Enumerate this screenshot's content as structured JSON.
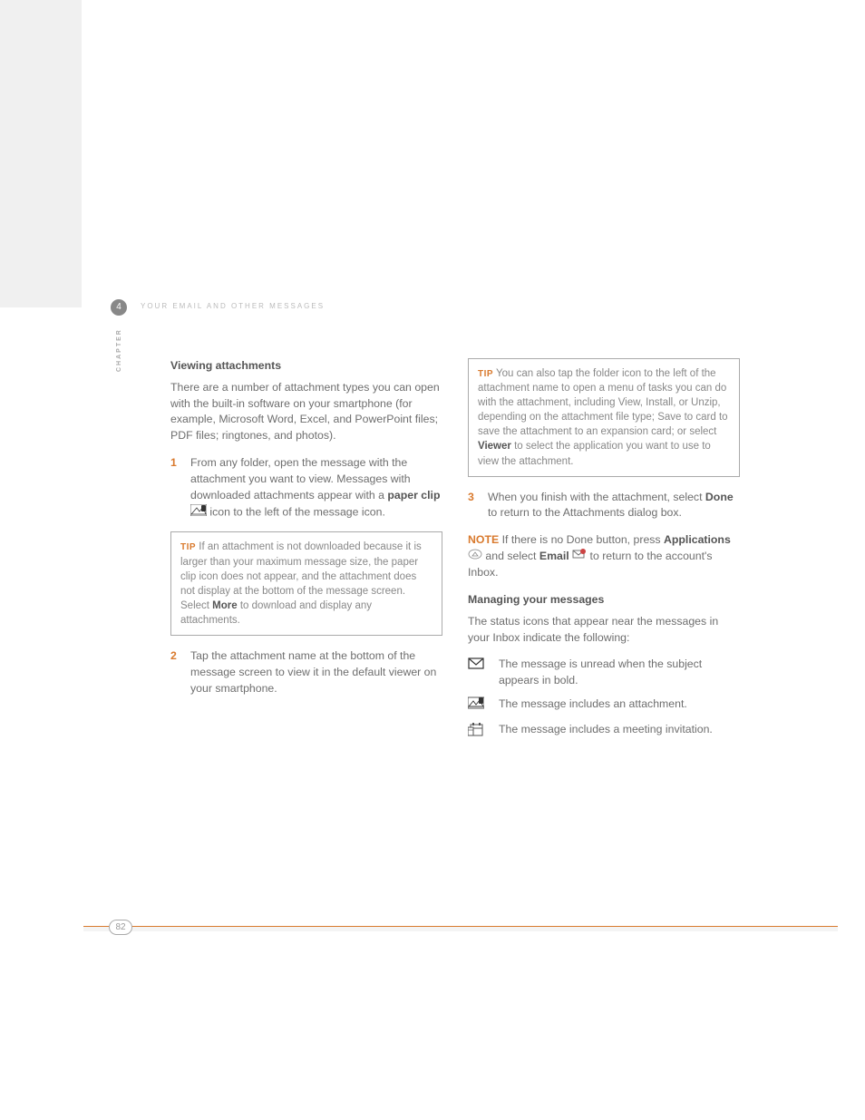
{
  "header": {
    "chapter_num": "4",
    "running_head": "YOUR EMAIL AND OTHER MESSAGES",
    "chapter_label": "CHAPTER"
  },
  "col1": {
    "heading": "Viewing attachments",
    "intro": "There are a number of attachment types you can open with the built-in software on your smartphone (for example, Microsoft Word, Excel, and PowerPoint files; PDF files; ringtones, and photos).",
    "step1_num": "1",
    "step1a": "From any folder, open the message with the attachment you want to view. Messages with downloaded attachments appear with a ",
    "step1_bold": "paper clip",
    "step1b": " icon to the left of the message icon.",
    "tip_label": "TIP",
    "tip_a": " If an attachment is not downloaded because it is larger than your maximum message size, the paper clip icon does not appear, and the attachment does not display at the bottom of the message screen. Select ",
    "tip_bold": "More",
    "tip_b": " to download and display any attachments.",
    "step2_num": "2",
    "step2": "Tap the attachment name at the bottom of the message screen to view it in the default viewer on your smartphone."
  },
  "col2": {
    "tip2_label": "TIP",
    "tip2a": " You can also tap the folder icon to the left of the attachment name to open a menu of tasks you can do with the attachment, including View, Install, or Unzip, depending on the attachment file type; Save to card to save the attachment to an expansion card; or select ",
    "tip2_bold": "Viewer",
    "tip2b": " to select the application you want to use to view the attachment.",
    "step3_num": "3",
    "step3a": "When you finish with the attachment, select ",
    "step3_bold": "Done",
    "step3b": " to return to the Attachments dialog box.",
    "note_label": "NOTE",
    "note_a": " If there is no Done button, press ",
    "note_apps": "Applications",
    "note_b": " and select ",
    "note_email": "Email",
    "note_c": " to return to the account's Inbox.",
    "heading2": "Managing your messages",
    "status_intro": "The status icons that appear near the messages in your Inbox indicate the following:",
    "row1": "The message is unread when the subject appears in bold.",
    "row2": "The message includes an attachment.",
    "row3": "The message includes a meeting invitation."
  },
  "page_number": "82"
}
